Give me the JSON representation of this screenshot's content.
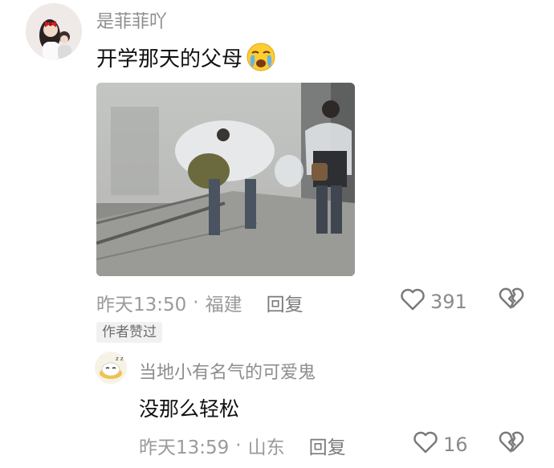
{
  "comment": {
    "username": "是菲菲吖",
    "text": "开学那天的父母",
    "emoji": "crying-face-emoji",
    "time": "昨天13:50",
    "separator": "·",
    "location": "福建",
    "reply_label": "回复",
    "likes": "391",
    "author_badge": "作者赞过"
  },
  "reply": {
    "username": "当地小有名气的可爱鬼",
    "text": "没那么轻松",
    "time": "昨天13:59",
    "separator": "·",
    "location": "山东",
    "reply_label": "回复",
    "likes": "16"
  },
  "icons": {
    "like": "heart-outline-icon",
    "dislike": "broken-heart-icon"
  },
  "colors": {
    "text": "#111111",
    "muted": "#9a9a9a",
    "emoji_yellow": "#ffcc33"
  }
}
